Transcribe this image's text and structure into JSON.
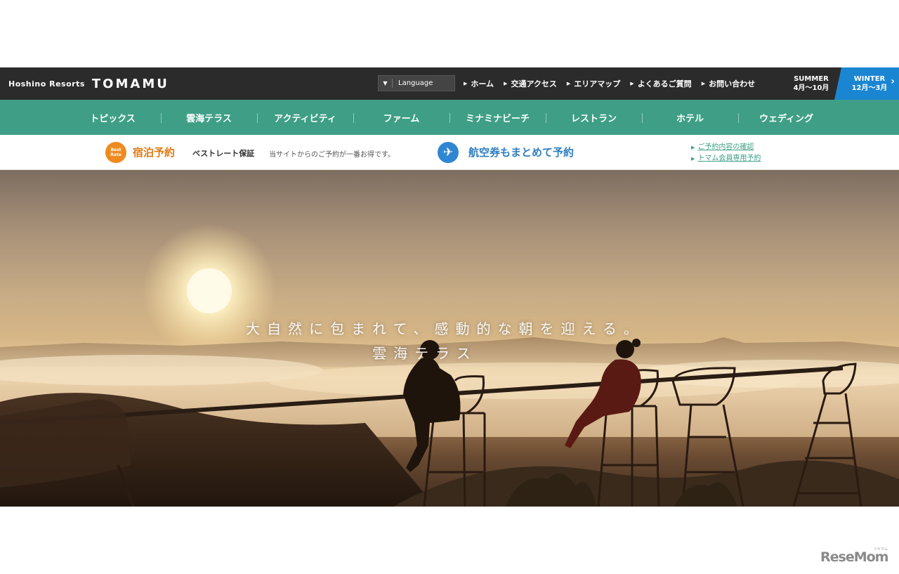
{
  "header": {
    "brand_small": "Hoshino Resorts",
    "brand_big": "TOMAMU",
    "language_label": "Language",
    "links": [
      "ホーム",
      "交通アクセス",
      "エリアマップ",
      "よくあるご質問",
      "お問い合わせ"
    ],
    "summer": {
      "label": "SUMMER",
      "period": "4月〜10月"
    },
    "winter": {
      "label": "WINTER",
      "period": "12月〜3月"
    },
    "colors": {
      "topbar": "#2b2b2b",
      "winter_accent": "#1a86d2"
    }
  },
  "nav": {
    "items": [
      "トピックス",
      "雲海テラス",
      "アクティビティ",
      "ファーム",
      "ミナミナビーチ",
      "レストラン",
      "ホテル",
      "ウェディング"
    ],
    "color": "#3e9f86"
  },
  "booking": {
    "badge_line1": "Best",
    "badge_line2": "Rate",
    "stay_title": "宿泊予約",
    "best_rate": "ベストレート保証",
    "best_note": "当サイトからのご予約が一番お得です。",
    "air_title": "航空券もまとめて予約",
    "sublinks": [
      "ご予約内容の確認",
      "トマム会員専用予約"
    ],
    "colors": {
      "stay": "#e07a12",
      "air": "#2f7fc1"
    }
  },
  "hero": {
    "line1": "大自然に包まれて、感動的な朝を迎える。",
    "line2": "雲海テラス"
  },
  "watermark": {
    "text": "ReseMom",
    "small": "リセマム"
  }
}
